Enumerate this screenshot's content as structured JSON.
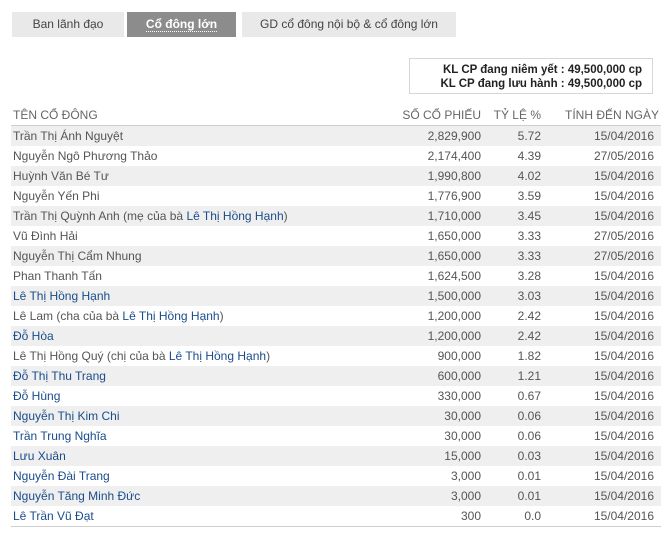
{
  "tabs": [
    {
      "label": "Ban lãnh đạo",
      "active": false
    },
    {
      "label": "Cổ đông lớn",
      "active": true
    },
    {
      "label": "GD cổ đông nội bộ & cổ đông lớn",
      "active": false
    }
  ],
  "summary": {
    "listed": "KL CP đang niêm yết : 49,500,000 cp",
    "outstanding": "KL CP đang lưu hành : 49,500,000 cp"
  },
  "table": {
    "headers": [
      "TÊN CỔ ĐÔNG",
      "SỐ CỔ PHIẾU",
      "TỶ LỆ %",
      "TÍNH ĐẾN NGÀY"
    ],
    "rows": [
      {
        "name": "Trần Thị Ánh Nguyệt",
        "shares": "2,829,900",
        "pct": "5.72",
        "date": "15/04/2016"
      },
      {
        "name": "Nguyễn Ngô Phương Thảo",
        "shares": "2,174,400",
        "pct": "4.39",
        "date": "27/05/2016"
      },
      {
        "name": "Huỳnh Văn Bé Tư",
        "shares": "1,990,800",
        "pct": "4.02",
        "date": "15/04/2016"
      },
      {
        "name": "Nguyễn Yến Phi",
        "shares": "1,776,900",
        "pct": "3.59",
        "date": "15/04/2016"
      },
      {
        "name_prefix": "Trần Thị Quỳnh Anh (mẹ của bà ",
        "name_link": "Lê Thị Hồng Hạnh",
        "name_suffix": ")",
        "shares": "1,710,000",
        "pct": "3.45",
        "date": "15/04/2016"
      },
      {
        "name": "Vũ Đình Hải",
        "shares": "1,650,000",
        "pct": "3.33",
        "date": "27/05/2016"
      },
      {
        "name": "Nguyễn Thị Cẩm Nhung",
        "shares": "1,650,000",
        "pct": "3.33",
        "date": "27/05/2016"
      },
      {
        "name": "Phan Thanh Tấn",
        "shares": "1,624,500",
        "pct": "3.28",
        "date": "15/04/2016"
      },
      {
        "name_link": "Lê Thị Hồng Hạnh",
        "shares": "1,500,000",
        "pct": "3.03",
        "date": "15/04/2016"
      },
      {
        "name_prefix": "Lê Lam (cha của bà ",
        "name_link": "Lê Thị Hồng Hạnh",
        "name_suffix": ")",
        "shares": "1,200,000",
        "pct": "2.42",
        "date": "15/04/2016"
      },
      {
        "name_link": "Đỗ Hòa",
        "shares": "1,200,000",
        "pct": "2.42",
        "date": "15/04/2016"
      },
      {
        "name_prefix": "Lê Thị Hồng Quý (chị của bà ",
        "name_link": "Lê Thị Hồng Hạnh",
        "name_suffix": ")",
        "shares": "900,000",
        "pct": "1.82",
        "date": "15/04/2016"
      },
      {
        "name_link": "Đỗ Thị Thu Trang",
        "shares": "600,000",
        "pct": "1.21",
        "date": "15/04/2016"
      },
      {
        "name_link": "Đỗ Hùng",
        "shares": "330,000",
        "pct": "0.67",
        "date": "15/04/2016"
      },
      {
        "name_link": "Nguyễn Thị Kim Chi",
        "shares": "30,000",
        "pct": "0.06",
        "date": "15/04/2016"
      },
      {
        "name_link": "Trần Trung Nghĩa",
        "shares": "30,000",
        "pct": "0.06",
        "date": "15/04/2016"
      },
      {
        "name_link": "Lưu Xuân",
        "shares": "15,000",
        "pct": "0.03",
        "date": "15/04/2016"
      },
      {
        "name_link": "Nguyễn Đài Trang",
        "shares": "3,000",
        "pct": "0.01",
        "date": "15/04/2016"
      },
      {
        "name_link": "Nguyễn Tăng Minh Đức",
        "shares": "3,000",
        "pct": "0.01",
        "date": "15/04/2016"
      },
      {
        "name_link": "Lê Trần Vũ Đạt",
        "shares": "300",
        "pct": "0.0",
        "date": "15/04/2016"
      }
    ]
  }
}
